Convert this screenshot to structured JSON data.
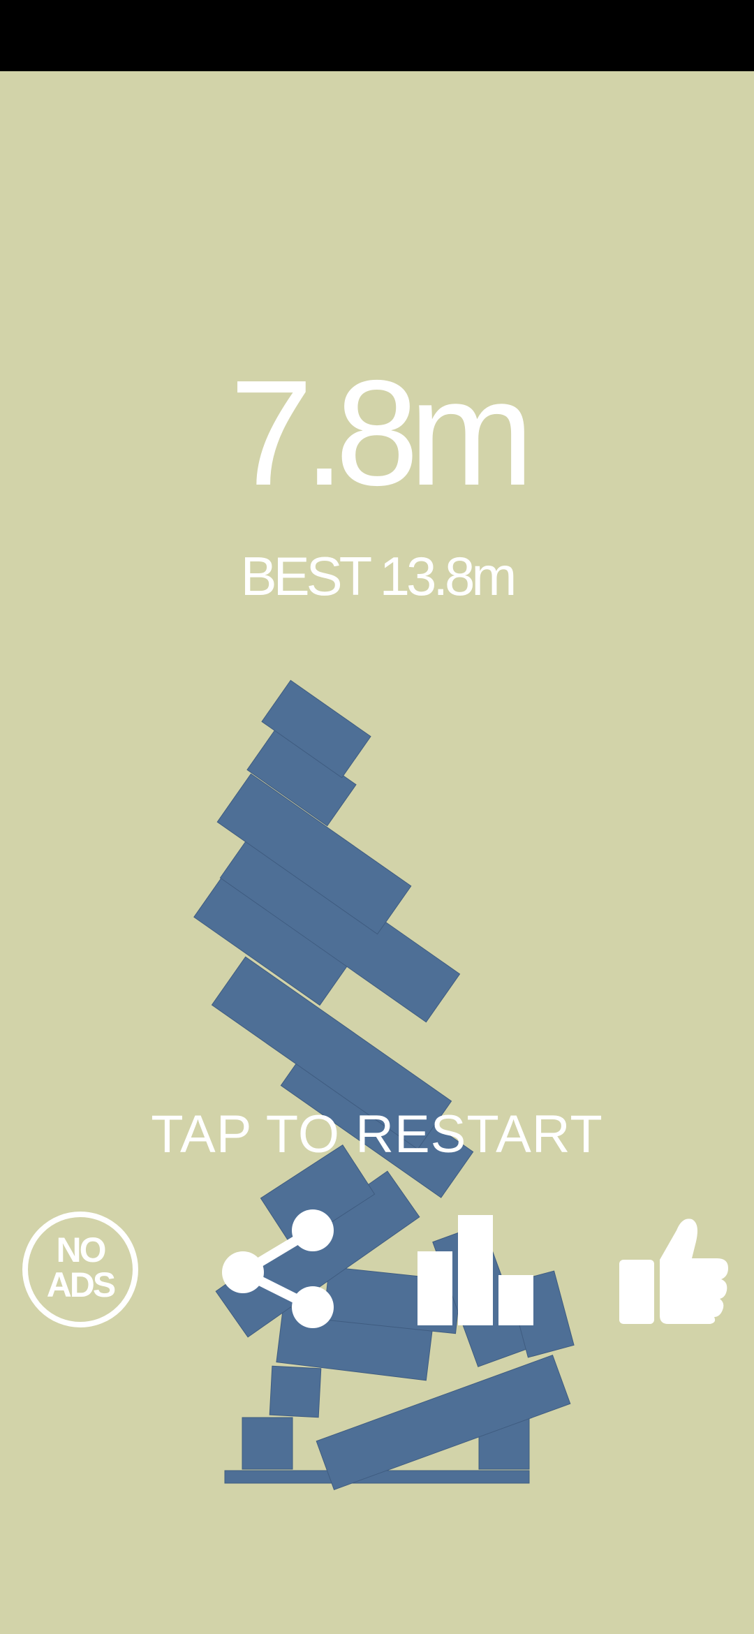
{
  "score": {
    "value": "7.8m"
  },
  "best": {
    "label": "BEST 13.8m"
  },
  "restart": {
    "label": "TAP TO RESTART"
  },
  "buttons": {
    "no_ads": {
      "label": "NO\nADS",
      "icon": "no-ads-icon"
    },
    "share": {
      "icon": "share-icon"
    },
    "leaderboard": {
      "icon": "leaderboard-icon"
    },
    "like": {
      "icon": "thumbs-up-icon"
    }
  },
  "colors": {
    "background": "#d2d3a9",
    "block": "#4e6f96",
    "text": "#ffffff",
    "status_bar": "#000000"
  }
}
